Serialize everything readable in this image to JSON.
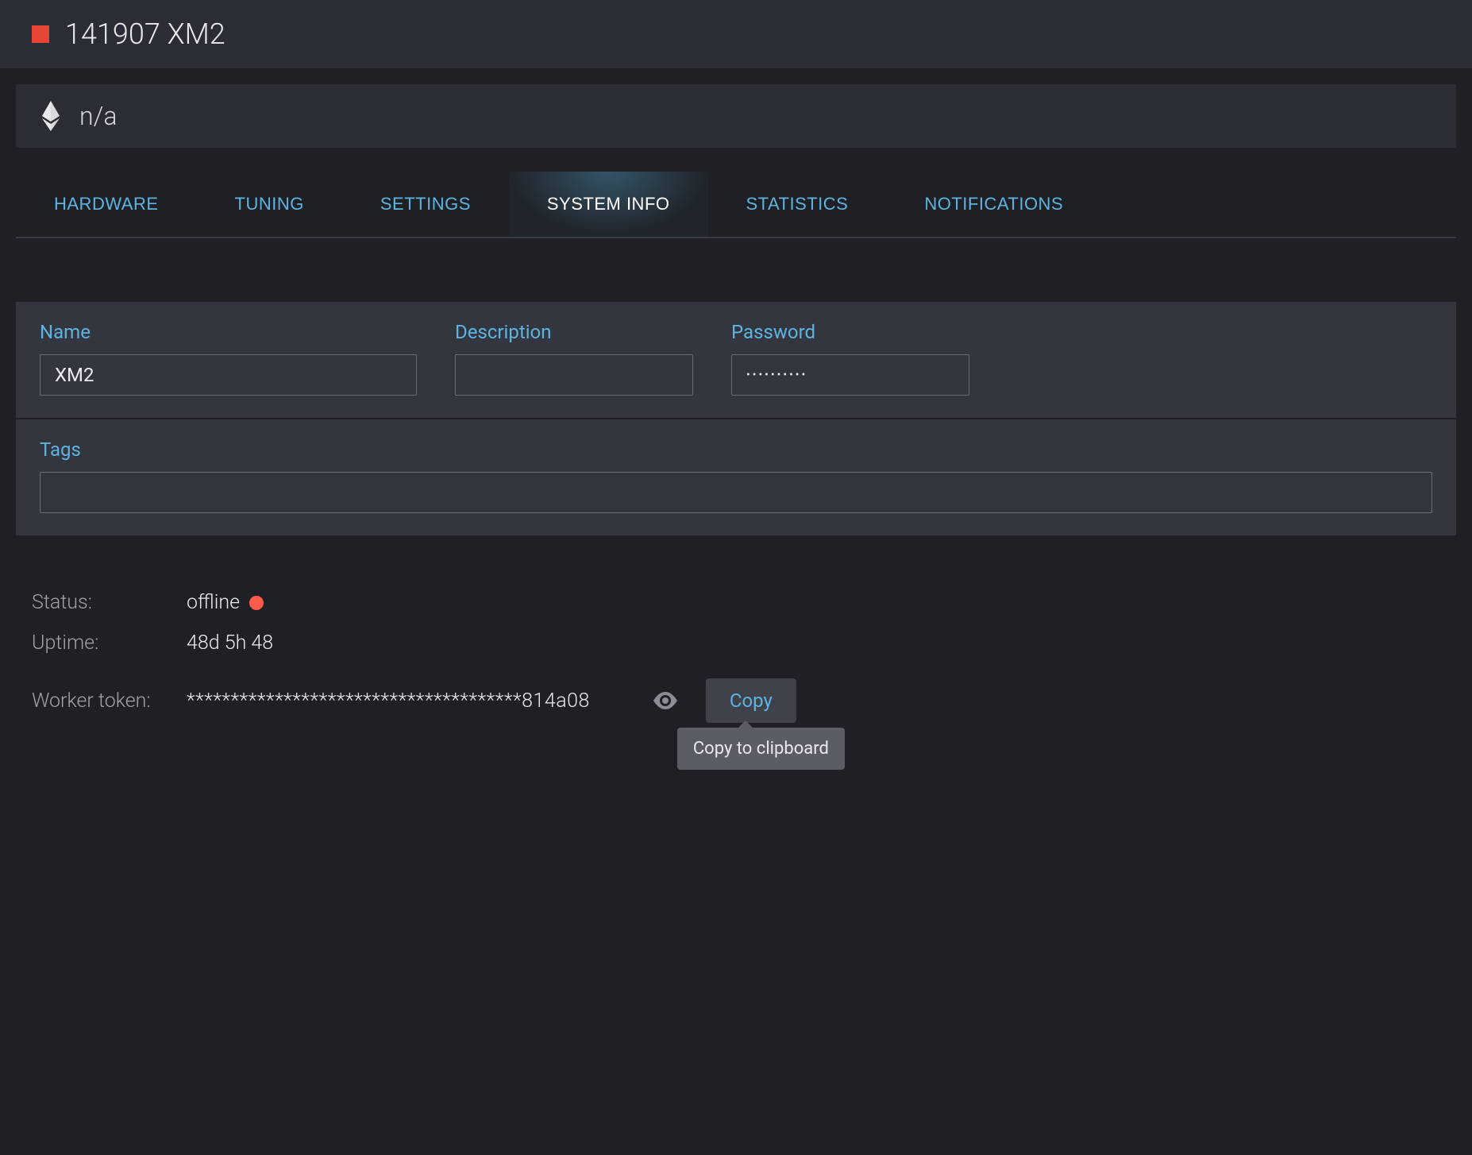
{
  "header": {
    "title": "141907 XM2"
  },
  "currency": {
    "label": "n/a"
  },
  "tabs": [
    {
      "label": "HARDWARE",
      "active": false
    },
    {
      "label": "TUNING",
      "active": false
    },
    {
      "label": "SETTINGS",
      "active": false
    },
    {
      "label": "SYSTEM INFO",
      "active": true
    },
    {
      "label": "STATISTICS",
      "active": false
    },
    {
      "label": "NOTIFICATIONS",
      "active": false
    }
  ],
  "form": {
    "name": {
      "label": "Name",
      "value": "XM2"
    },
    "description": {
      "label": "Description",
      "value": ""
    },
    "password": {
      "label": "Password",
      "value": "••••••••••"
    },
    "tags": {
      "label": "Tags",
      "value": ""
    }
  },
  "status": {
    "status_label": "Status:",
    "status_value": "offline",
    "uptime_label": "Uptime:",
    "uptime_value": "48d 5h 48",
    "token_label": "Worker token:",
    "token_value": "**************************************814a08",
    "copy_label": "Copy",
    "tooltip": "Copy to clipboard"
  }
}
